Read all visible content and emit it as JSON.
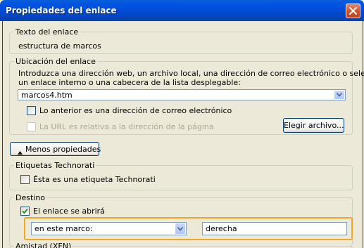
{
  "window": {
    "title": "Propiedades del enlace"
  },
  "link_text": {
    "group_label": "Texto del enlace",
    "value": "estructura de marcos"
  },
  "location": {
    "group_label": "Ubicación del enlace",
    "description_line1": "Introduzca una dirección web, un archivo local, una dirección de correo electrónico o seleccione",
    "description_line2": "un enlace interno o una cabecera de la lista desplegable:",
    "url_value": "marcos4.htm",
    "email_checkbox": {
      "label": "Lo anterior es una dirección de correo electrónico",
      "checked": false
    },
    "relative_checkbox": {
      "label": "La URL es relativa a la dirección de la página",
      "checked": false,
      "disabled": true
    },
    "choose_file_button": "Elegir archivo..."
  },
  "less_properties_button": "Menos propiedades",
  "technorati": {
    "group_label": "Etiquetas Technorati",
    "checkbox": {
      "label": "Ésta es una etiqueta Technorati",
      "checked": false
    }
  },
  "destination": {
    "group_label": "Destino",
    "open_checkbox": {
      "label": "El enlace se abrirá",
      "checked": true
    },
    "target_select": "en este marco:",
    "frame_name": "derecha"
  },
  "friendship": {
    "group_label": "Amistad (XFN)"
  },
  "colors": {
    "titlebar": "#0054e3",
    "highlight": "#f5a623",
    "dialog_bg": "#ece9d8"
  }
}
